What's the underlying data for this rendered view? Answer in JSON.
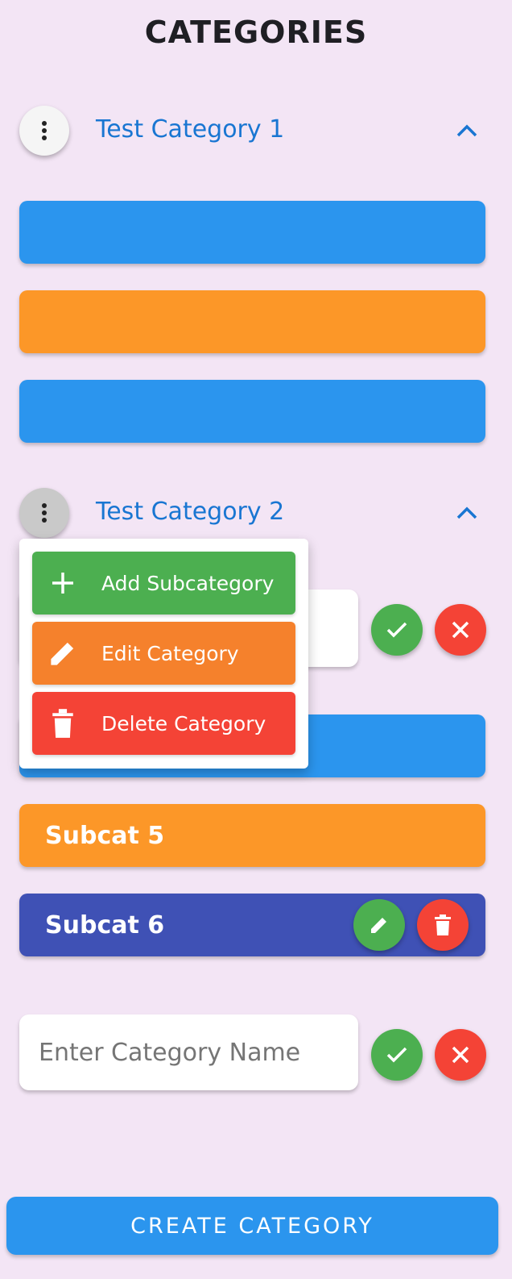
{
  "page": {
    "title": "CATEGORIES"
  },
  "categories": [
    {
      "name": "Test Category 1",
      "subcategories": [
        {
          "label": "",
          "color": "#2b95ee"
        },
        {
          "label": "",
          "color": "#fc9728"
        },
        {
          "label": "",
          "color": "#2b95ee"
        }
      ]
    },
    {
      "name": "Test Category 2",
      "subcategory_input": {
        "value": "",
        "placeholder": ""
      },
      "subcategories": [
        {
          "label": "",
          "color": "#2b95ee"
        },
        {
          "label": "Subcat 5",
          "color": "#fc9728"
        },
        {
          "label": "Subcat 6",
          "color": "#3f51b5"
        }
      ]
    }
  ],
  "context_menu": {
    "items": [
      {
        "label": "Add Subcategory",
        "icon": "plus-icon",
        "color": "#4caf50"
      },
      {
        "label": "Edit Category",
        "icon": "pencil-icon",
        "color": "#f5812c"
      },
      {
        "label": "Delete Category",
        "icon": "trash-icon",
        "color": "#f44336"
      }
    ]
  },
  "new_category": {
    "placeholder": "Enter Category Name",
    "value": ""
  },
  "create_button": {
    "label": "CREATE CATEGORY"
  },
  "colors": {
    "background": "#f3e5f5",
    "accent_blue": "#2b95ee",
    "accent_orange": "#fc9728",
    "accent_indigo": "#3f51b5",
    "confirm_green": "#4caf50",
    "cancel_red": "#f44336",
    "title_blue": "#1976d2"
  }
}
